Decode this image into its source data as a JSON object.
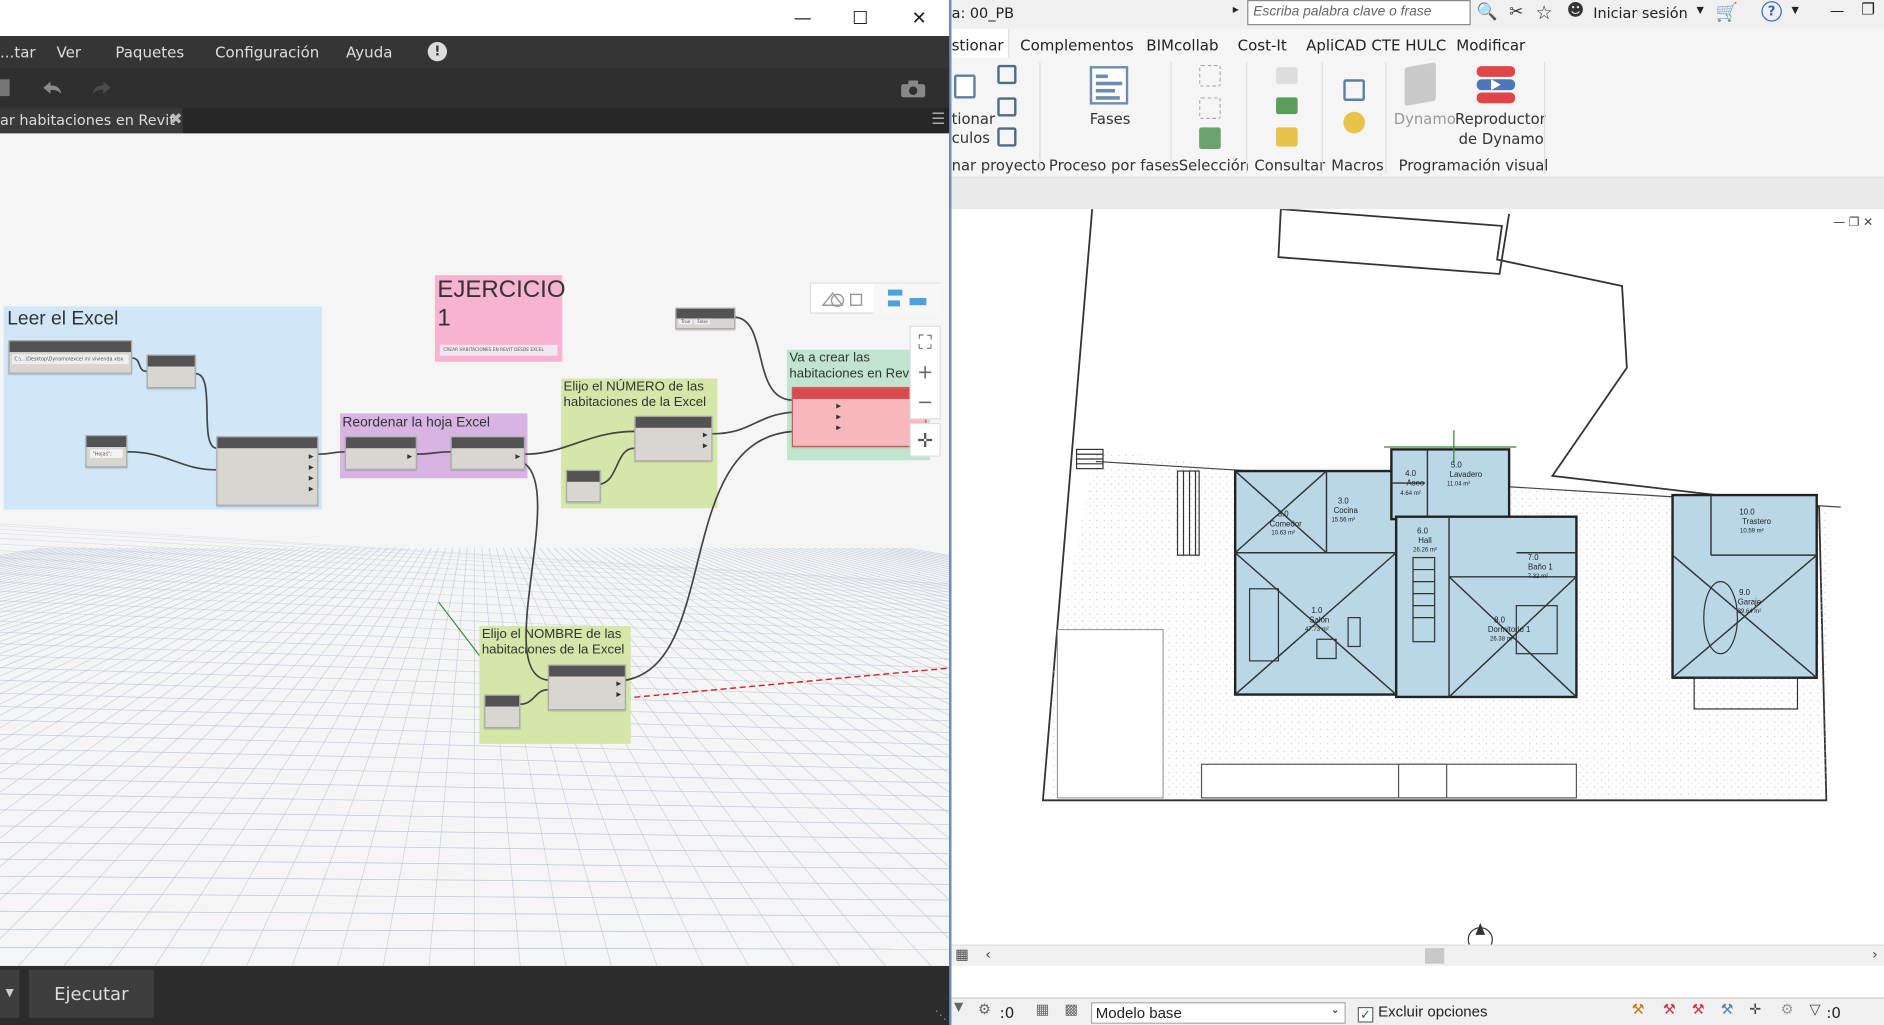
{
  "dynamo": {
    "menu": [
      "...tar",
      "Ver",
      "Paquetes",
      "Configuración",
      "Ayuda"
    ],
    "tab_label": "ar habitaciones en Revit",
    "run_label": "Ejecutar",
    "groups": {
      "leer": "Leer el Excel",
      "ejercicio": "EJERCICIO\n1",
      "ejercicio_sub": "CREAR HABITACIONES EN REVIT DESDE EXCEL",
      "reordenar": "Reordenar la hoja Excel",
      "numero": "Elijo el NÚMERO de las\nhabitaciones de la Excel",
      "nombre": "Elijo el NOMBRE de las\nhabitaciones de la Excel",
      "crear": "Va a crear las\nhabitaciones en Revit"
    },
    "node_texts": {
      "file_path": "C:\\...\\Desktop\\Dynamo\\excel mi vivienda.xlsx",
      "sheet": "\"Hojas\";",
      "bool_true": "True",
      "bool_false": "False"
    }
  },
  "revit": {
    "title": "a: 00_PB",
    "search_placeholder": "Escriba palabra clave o frase",
    "signin": "Iniciar sesión",
    "tabs": [
      "stionar",
      "Complementos",
      "BIMcollab",
      "Cost-It",
      "ApliCAD CTE HULC",
      "Modificar"
    ],
    "ribbon": {
      "gest1": "tionar",
      "gest2": "culos",
      "fases": "Fases",
      "dynamo": "Dynamo",
      "repro1": "Reproductor",
      "repro2": "de Dynamo",
      "panels": [
        "nar proyecto",
        "Proceso por fases",
        "Selección",
        "Consultar",
        "Macros",
        "Programación visual"
      ]
    },
    "status": {
      "value": ":0",
      "model": "Modelo base",
      "exclude": "Excluir opciones",
      "filter": ":0"
    },
    "rooms": [
      {
        "num": "3.0",
        "name": "Comedor",
        "area": "10.63 m²"
      },
      {
        "num": "3.0",
        "name": "Cocina",
        "area": "15.56 m²"
      },
      {
        "num": "4.0",
        "name": "Aseo",
        "area": "4.64 m²"
      },
      {
        "num": "5.0",
        "name": "Lavadero",
        "area": "11.04 m²"
      },
      {
        "num": "6.0",
        "name": "Hall",
        "area": "26.26 m²"
      },
      {
        "num": "1.0",
        "name": "Salón",
        "area": "47.73 m²"
      },
      {
        "num": "7.0",
        "name": "Baño 1",
        "area": "7.32 m²"
      },
      {
        "num": "8.0",
        "name": "Dormitorio 1",
        "area": "26.38 m²"
      },
      {
        "num": "10.0",
        "name": "Trastero",
        "area": "10.59 m²"
      },
      {
        "num": "9.0",
        "name": "Garaje",
        "area": "39.64 m²"
      }
    ]
  },
  "colors": {
    "dynamo_bg": "#3c3c3c",
    "group_blue": "#cfe7f6",
    "group_pink": "#f7b3cf",
    "group_purple": "#d8b4e2",
    "group_green": "#d4e6a8",
    "group_teal": "#bfe5cf",
    "revit_room": "#b9d7e6"
  }
}
